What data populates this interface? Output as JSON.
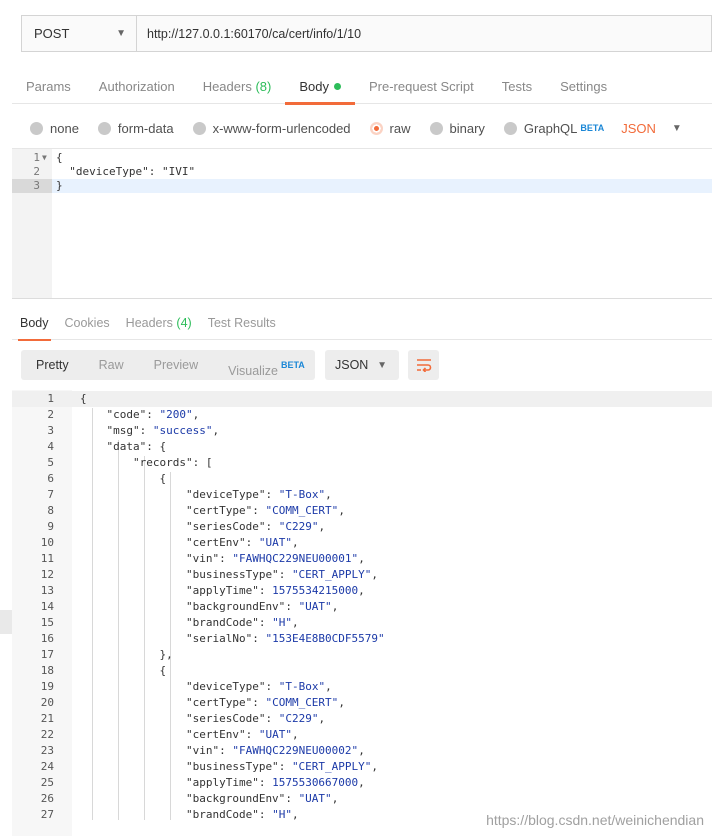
{
  "request": {
    "method": "POST",
    "url": "http://127.0.0.1:60170/ca/cert/info/1/10"
  },
  "request_tabs": [
    {
      "label": "Params"
    },
    {
      "label": "Authorization"
    },
    {
      "label": "Headers",
      "count": "(8)"
    },
    {
      "label": "Body",
      "active": true
    },
    {
      "label": "Pre-request Script"
    },
    {
      "label": "Tests"
    },
    {
      "label": "Settings"
    }
  ],
  "body_types": {
    "none": "none",
    "form_data": "form-data",
    "urlencoded": "x-www-form-urlencoded",
    "raw": "raw",
    "binary": "binary",
    "graphql": "GraphQL",
    "beta": "BETA",
    "format": "JSON",
    "selected": "raw"
  },
  "request_body": [
    {
      "ln": "1",
      "text": "{"
    },
    {
      "ln": "2",
      "text": "  \"deviceType\": \"IVI\""
    },
    {
      "ln": "3",
      "text": "}"
    }
  ],
  "response_tabs": {
    "body": "Body",
    "cookies": "Cookies",
    "headers": "Headers",
    "headers_count": "(4)",
    "test_results": "Test Results"
  },
  "response_views": {
    "pretty": "Pretty",
    "raw": "Raw",
    "preview": "Preview",
    "visualize": "Visualize",
    "beta": "BETA",
    "format": "JSON"
  },
  "response_body": [
    "{",
    "    \"code\": \"200\",",
    "    \"msg\": \"success\",",
    "    \"data\": {",
    "        \"records\": [",
    "            {",
    "                \"deviceType\": \"T-Box\",",
    "                \"certType\": \"COMM_CERT\",",
    "                \"seriesCode\": \"C229\",",
    "                \"certEnv\": \"UAT\",",
    "                \"vin\": \"FAWHQC229NEU00001\",",
    "                \"businessType\": \"CERT_APPLY\",",
    "                \"applyTime\": 1575534215000,",
    "                \"backgroundEnv\": \"UAT\",",
    "                \"brandCode\": \"H\",",
    "                \"serialNo\": \"153E4E8B0CDF5579\"",
    "            },",
    "            {",
    "                \"deviceType\": \"T-Box\",",
    "                \"certType\": \"COMM_CERT\",",
    "                \"seriesCode\": \"C229\",",
    "                \"certEnv\": \"UAT\",",
    "                \"vin\": \"FAWHQC229NEU00002\",",
    "                \"businessType\": \"CERT_APPLY\",",
    "                \"applyTime\": 1575530667000,",
    "                \"backgroundEnv\": \"UAT\",",
    "                \"brandCode\": \"H\","
  ],
  "watermark": "https://blog.csdn.net/weinichendian"
}
